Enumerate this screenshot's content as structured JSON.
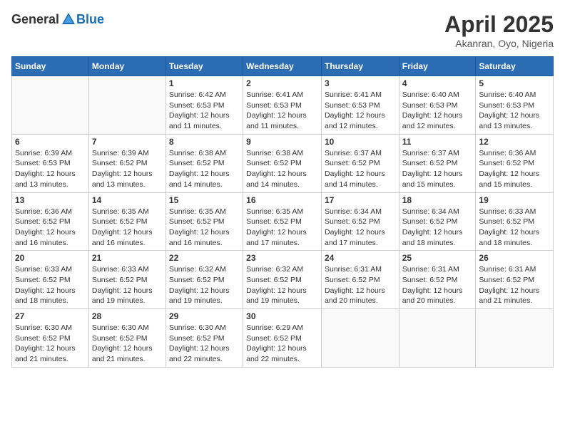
{
  "logo": {
    "general": "General",
    "blue": "Blue"
  },
  "header": {
    "title": "April 2025",
    "location": "Akanran, Oyo, Nigeria"
  },
  "weekdays": [
    "Sunday",
    "Monday",
    "Tuesday",
    "Wednesday",
    "Thursday",
    "Friday",
    "Saturday"
  ],
  "weeks": [
    [
      {
        "day": "",
        "info": ""
      },
      {
        "day": "",
        "info": ""
      },
      {
        "day": "1",
        "info": "Sunrise: 6:42 AM\nSunset: 6:53 PM\nDaylight: 12 hours and 11 minutes."
      },
      {
        "day": "2",
        "info": "Sunrise: 6:41 AM\nSunset: 6:53 PM\nDaylight: 12 hours and 11 minutes."
      },
      {
        "day": "3",
        "info": "Sunrise: 6:41 AM\nSunset: 6:53 PM\nDaylight: 12 hours and 12 minutes."
      },
      {
        "day": "4",
        "info": "Sunrise: 6:40 AM\nSunset: 6:53 PM\nDaylight: 12 hours and 12 minutes."
      },
      {
        "day": "5",
        "info": "Sunrise: 6:40 AM\nSunset: 6:53 PM\nDaylight: 12 hours and 13 minutes."
      }
    ],
    [
      {
        "day": "6",
        "info": "Sunrise: 6:39 AM\nSunset: 6:53 PM\nDaylight: 12 hours and 13 minutes."
      },
      {
        "day": "7",
        "info": "Sunrise: 6:39 AM\nSunset: 6:52 PM\nDaylight: 12 hours and 13 minutes."
      },
      {
        "day": "8",
        "info": "Sunrise: 6:38 AM\nSunset: 6:52 PM\nDaylight: 12 hours and 14 minutes."
      },
      {
        "day": "9",
        "info": "Sunrise: 6:38 AM\nSunset: 6:52 PM\nDaylight: 12 hours and 14 minutes."
      },
      {
        "day": "10",
        "info": "Sunrise: 6:37 AM\nSunset: 6:52 PM\nDaylight: 12 hours and 14 minutes."
      },
      {
        "day": "11",
        "info": "Sunrise: 6:37 AM\nSunset: 6:52 PM\nDaylight: 12 hours and 15 minutes."
      },
      {
        "day": "12",
        "info": "Sunrise: 6:36 AM\nSunset: 6:52 PM\nDaylight: 12 hours and 15 minutes."
      }
    ],
    [
      {
        "day": "13",
        "info": "Sunrise: 6:36 AM\nSunset: 6:52 PM\nDaylight: 12 hours and 16 minutes."
      },
      {
        "day": "14",
        "info": "Sunrise: 6:35 AM\nSunset: 6:52 PM\nDaylight: 12 hours and 16 minutes."
      },
      {
        "day": "15",
        "info": "Sunrise: 6:35 AM\nSunset: 6:52 PM\nDaylight: 12 hours and 16 minutes."
      },
      {
        "day": "16",
        "info": "Sunrise: 6:35 AM\nSunset: 6:52 PM\nDaylight: 12 hours and 17 minutes."
      },
      {
        "day": "17",
        "info": "Sunrise: 6:34 AM\nSunset: 6:52 PM\nDaylight: 12 hours and 17 minutes."
      },
      {
        "day": "18",
        "info": "Sunrise: 6:34 AM\nSunset: 6:52 PM\nDaylight: 12 hours and 18 minutes."
      },
      {
        "day": "19",
        "info": "Sunrise: 6:33 AM\nSunset: 6:52 PM\nDaylight: 12 hours and 18 minutes."
      }
    ],
    [
      {
        "day": "20",
        "info": "Sunrise: 6:33 AM\nSunset: 6:52 PM\nDaylight: 12 hours and 18 minutes."
      },
      {
        "day": "21",
        "info": "Sunrise: 6:33 AM\nSunset: 6:52 PM\nDaylight: 12 hours and 19 minutes."
      },
      {
        "day": "22",
        "info": "Sunrise: 6:32 AM\nSunset: 6:52 PM\nDaylight: 12 hours and 19 minutes."
      },
      {
        "day": "23",
        "info": "Sunrise: 6:32 AM\nSunset: 6:52 PM\nDaylight: 12 hours and 19 minutes."
      },
      {
        "day": "24",
        "info": "Sunrise: 6:31 AM\nSunset: 6:52 PM\nDaylight: 12 hours and 20 minutes."
      },
      {
        "day": "25",
        "info": "Sunrise: 6:31 AM\nSunset: 6:52 PM\nDaylight: 12 hours and 20 minutes."
      },
      {
        "day": "26",
        "info": "Sunrise: 6:31 AM\nSunset: 6:52 PM\nDaylight: 12 hours and 21 minutes."
      }
    ],
    [
      {
        "day": "27",
        "info": "Sunrise: 6:30 AM\nSunset: 6:52 PM\nDaylight: 12 hours and 21 minutes."
      },
      {
        "day": "28",
        "info": "Sunrise: 6:30 AM\nSunset: 6:52 PM\nDaylight: 12 hours and 21 minutes."
      },
      {
        "day": "29",
        "info": "Sunrise: 6:30 AM\nSunset: 6:52 PM\nDaylight: 12 hours and 22 minutes."
      },
      {
        "day": "30",
        "info": "Sunrise: 6:29 AM\nSunset: 6:52 PM\nDaylight: 12 hours and 22 minutes."
      },
      {
        "day": "",
        "info": ""
      },
      {
        "day": "",
        "info": ""
      },
      {
        "day": "",
        "info": ""
      }
    ]
  ]
}
